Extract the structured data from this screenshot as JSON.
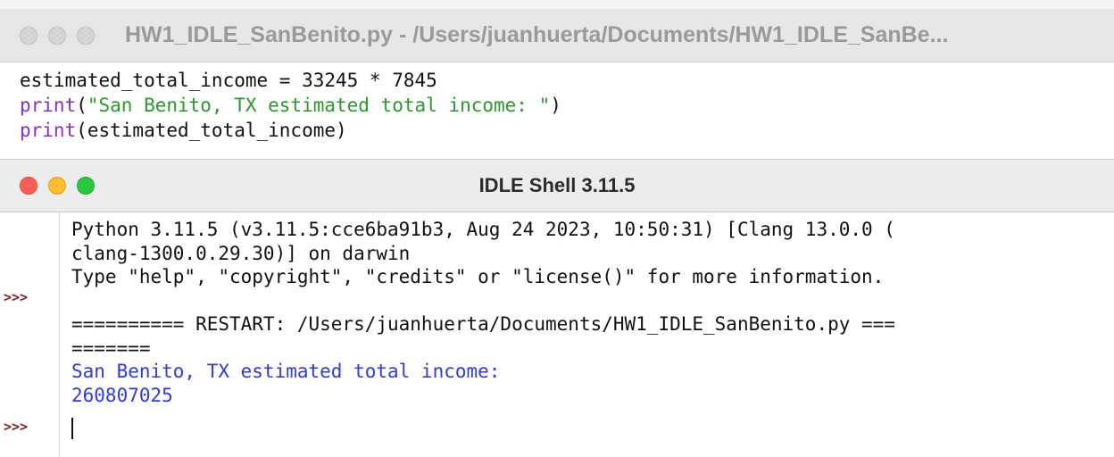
{
  "editor": {
    "title": "HW1_IDLE_SanBenito.py - /Users/juanhuerta/Documents/HW1_IDLE_SanBe...",
    "lines": [
      {
        "text": "estimated_total_income = 33245 * 7845"
      },
      {
        "fn": "print",
        "open": "(",
        "str": "\"San Benito, TX estimated total income: \"",
        "close": ")"
      },
      {
        "fn": "print",
        "rest": "(estimated_total_income)"
      }
    ]
  },
  "shell": {
    "title": "IDLE Shell 3.11.5",
    "prompt": ">>>",
    "banner_line1": "Python 3.11.5 (v3.11.5:cce6ba91b3, Aug 24 2023, 10:50:31) [Clang 13.0.0 (",
    "banner_line2": "clang-1300.0.29.30)] on darwin",
    "banner_line3": "Type \"help\", \"copyright\", \"credits\" or \"license()\" for more information.",
    "restart_line1": "========== RESTART: /Users/juanhuerta/Documents/HW1_IDLE_SanBenito.py ===",
    "restart_line2": "=======",
    "output_label": "San Benito, TX estimated total income:",
    "output_value": "260807025"
  },
  "colors": {
    "builtin": "#8b2fc9",
    "string": "#2a9a2a",
    "output": "#2e3be0",
    "prompt": "#7a1f1f",
    "close_button": "#ff5f57",
    "minimize_button": "#febc2e",
    "zoom_button": "#28c840"
  }
}
